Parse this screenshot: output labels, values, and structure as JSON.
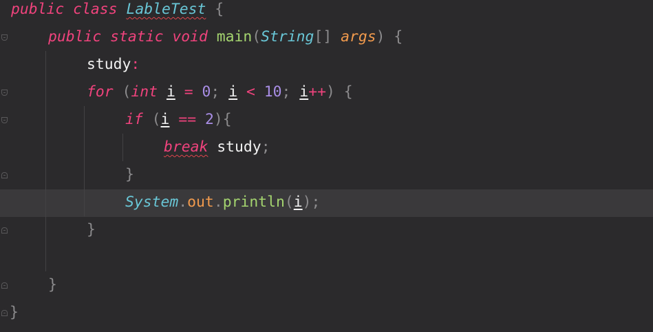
{
  "code": {
    "l1": {
      "kw_public": "public",
      "kw_class": "class",
      "class_name": "LableTest",
      "open_brace": "{"
    },
    "l2": {
      "kw_public": "public",
      "kw_static": "static",
      "kw_void": "void",
      "method": "main",
      "paren_open": "(",
      "type": "String",
      "brackets": "[]",
      "param": "args",
      "paren_close": ")",
      "open_brace": "{"
    },
    "l3": {
      "label": "study",
      "colon": ":"
    },
    "l4": {
      "kw_for": "for",
      "paren_open": "(",
      "kw_int": "int",
      "var1": "i",
      "eq": "=",
      "zero": "0",
      "semi1": ";",
      "var2": "i",
      "lt": "<",
      "ten": "10",
      "semi2": ";",
      "var3": "i",
      "inc": "++",
      "paren_close": ")",
      "open_brace": "{"
    },
    "l5": {
      "kw_if": "if",
      "paren_open": "(",
      "var": "i",
      "eqeq": "==",
      "two": "2",
      "paren_close": ")",
      "open_brace": "{"
    },
    "l6": {
      "kw_break": "break",
      "label": "study",
      "semi": ";"
    },
    "l7": {
      "close_brace": "}"
    },
    "l8": {
      "system": "System",
      "dot1": ".",
      "out": "out",
      "dot2": ".",
      "println": "println",
      "paren_open": "(",
      "var": "i",
      "paren_close": ")",
      "semi": ";"
    },
    "l9": {
      "close_brace": "}"
    },
    "l11": {
      "close_brace": "}"
    },
    "l12": {
      "close_brace": "}"
    }
  },
  "colors": {
    "background": "#2b2a2c",
    "current_line": "#3a393b",
    "keyword": "#f0437d",
    "type": "#69c6d6",
    "method": "#a4d46f",
    "parameter": "#f19a4d",
    "number": "#a98ee6",
    "error_squiggle": "#e0454d"
  }
}
